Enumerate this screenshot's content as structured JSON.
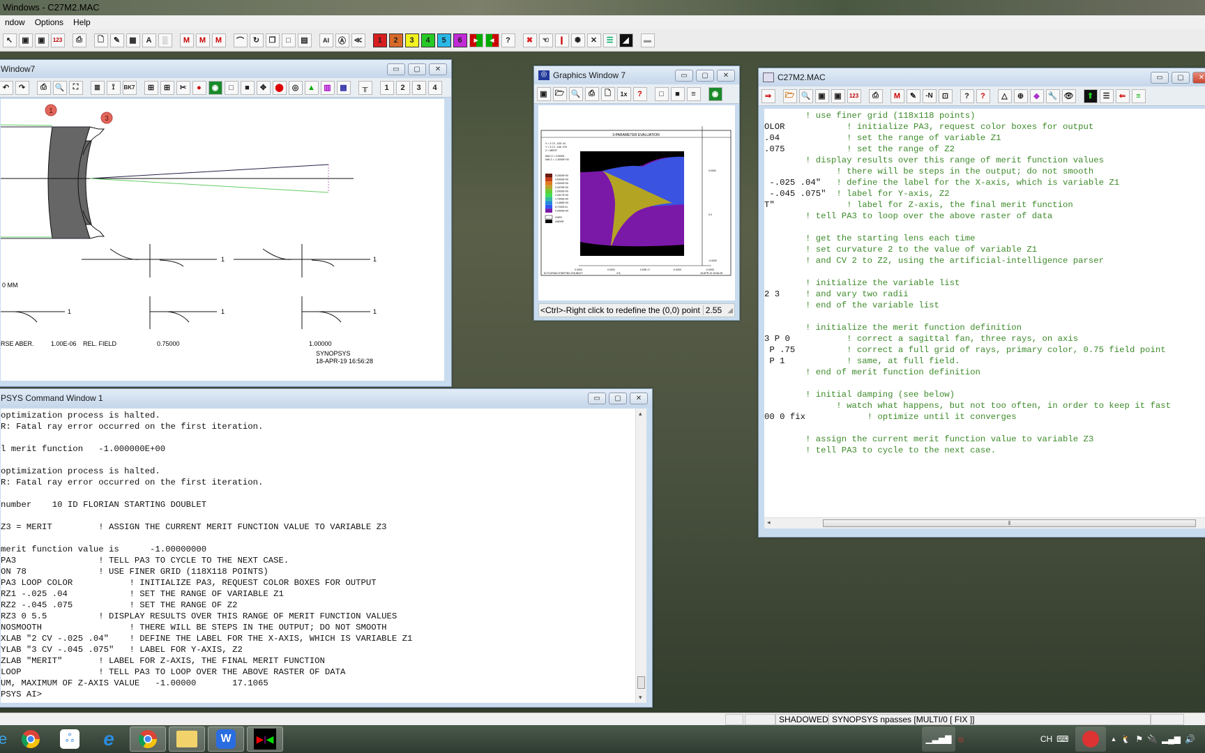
{
  "app": {
    "title": "Windows - C27M2.MAC",
    "menu": [
      "ndow",
      "Options",
      "Help"
    ]
  },
  "main_toolbar": {
    "numbered_buttons": [
      {
        "label": "1",
        "color": "#d81e1e"
      },
      {
        "label": "2",
        "color": "#d86a2a"
      },
      {
        "label": "3",
        "color": "#f2f21e"
      },
      {
        "label": "4",
        "color": "#26c926"
      },
      {
        "label": "5",
        "color": "#2ab8e6"
      },
      {
        "label": "6",
        "color": "#c22ad8"
      }
    ],
    "question_label": "?"
  },
  "lens_window": {
    "title": "Window7",
    "page_buttons": [
      "1",
      "2",
      "3",
      "4"
    ],
    "surface_markers": [
      "1",
      "3"
    ],
    "fan_plot_labels": {
      "units": "0   MM",
      "curve_end_label": "1",
      "aberration_label": "RSE ABER.",
      "scale": "1.00E-06",
      "rel_field_label": "REL. FIELD",
      "field_075": "0.75000",
      "field_100": "1.00000",
      "program": "SYNOPSYS",
      "timestamp": "18-APR-19  16:56:28"
    }
  },
  "graphics_window": {
    "title": "Graphics Window 7",
    "toolbar_1x": "1x",
    "plot": {
      "title": "3-PARAMETER EVALUATION",
      "x_label": "X =  2 CV -.025 .04",
      "y_label": "Y =  3 CV -.045 .075",
      "z_label": "Z =  MERIT",
      "max_z": "MAX Z =    0.00000",
      "min_z": "MIN Z =   -1.0000E+00",
      "legend": [
        "5.2500E+00",
        "4.6000E+00",
        "4.0000E+00",
        "3.4375E+00",
        "2.9000E+00",
        "2.2917E+00",
        "1.7000E+00",
        "1.1458E+00",
        "5.7292E-01",
        "0.0000E+00"
      ],
      "legend_colors": [
        "#6b1a10",
        "#c8401a",
        "#e07a20",
        "#b8a42a",
        "#66cc33",
        "#44dd55",
        "#33bb99",
        "#2288dd",
        "#3355ee",
        "#7a18a8"
      ],
      "over_label": "OVER",
      "under_label": "UNDER",
      "y_ticks": [
        "0.0000",
        "0.0",
        "-0.0000"
      ],
      "x_ticks": [
        "0.0000",
        "0.0000",
        "0.00E-17",
        "-0.0000",
        "-0.0000"
      ],
      "footer_left": "ID FLORIAN STARTING DOUBLET",
      "footer_mid": "3 N",
      "footer_right": "18-APR-19  16:56:28"
    },
    "status_text": "<Ctrl>-Right click to redefine the (0,0) point",
    "status_value": "2.55"
  },
  "macro_window": {
    "title": "C27M2.MAC",
    "toolbar_n": "-N",
    "lines": [
      {
        "code": "",
        "comment": "        ! use finer grid (118x118 points)"
      },
      {
        "code": "OLOR",
        "comment": "            ! initialize PA3, request color boxes for output"
      },
      {
        "code": ".04",
        "comment": "             ! set the range of variable Z1"
      },
      {
        "code": ".075",
        "comment": "            ! set the range of Z2"
      },
      {
        "code": "",
        "comment": "        ! display results over this range of merit function values"
      },
      {
        "code": "",
        "comment": "              ! there will be steps in the output; do not smooth"
      },
      {
        "code": " -.025 .04\"",
        "comment": "   ! define the label for the X-axis, which is variable Z1"
      },
      {
        "code": " -.045 .075\"",
        "comment": "  ! label for Y-axis, Z2"
      },
      {
        "code": "T\"",
        "comment": "              ! label for Z-axis, the final merit function"
      },
      {
        "code": "",
        "comment": "        ! tell PA3 to loop over the above raster of data"
      },
      {
        "code": "",
        "comment": ""
      },
      {
        "code": "",
        "comment": "        ! get the starting lens each time"
      },
      {
        "code": "",
        "comment": "        ! set curvature 2 to the value of variable Z1"
      },
      {
        "code": "",
        "comment": "        ! and CV 2 to Z2, using the artificial-intelligence parser"
      },
      {
        "code": "",
        "comment": ""
      },
      {
        "code": "",
        "comment": "        ! initialize the variable list"
      },
      {
        "code": "2 3",
        "comment": "     ! and vary two radii"
      },
      {
        "code": "",
        "comment": "        ! end of the variable list"
      },
      {
        "code": "",
        "comment": ""
      },
      {
        "code": "",
        "comment": "        ! initialize the merit function definition"
      },
      {
        "code": "3 P 0",
        "comment": "           ! correct a sagittal fan, three rays, on axis"
      },
      {
        "code": " P .75",
        "comment": "          ! correct a full grid of rays, primary color, 0.75 field point"
      },
      {
        "code": " P 1",
        "comment": "            ! same, at full field."
      },
      {
        "code": "",
        "comment": "        ! end of merit function definition"
      },
      {
        "code": "",
        "comment": ""
      },
      {
        "code": "",
        "comment": "        ! initial damping (see below)"
      },
      {
        "code": "",
        "comment": "              ! watch what happens, but not too often, in order to keep it fast"
      },
      {
        "code": "00 0 fix",
        "comment": "            ! optimize until it converges"
      },
      {
        "code": "",
        "comment": ""
      },
      {
        "code": "",
        "comment": "        ! assign the current merit function value to variable Z3"
      },
      {
        "code": "",
        "comment": "        ! tell PA3 to cycle to the next case."
      }
    ]
  },
  "command_window": {
    "title": "PSYS Command Window 1",
    "lines": [
      "optimization process is halted.",
      "R: Fatal ray error occurred on the first iteration.",
      "",
      "l merit function   -1.000000E+00",
      "",
      "optimization process is halted.",
      "R: Fatal ray error occurred on the first iteration.",
      "",
      "number    10 ID FLORIAN STARTING DOUBLET",
      "",
      "Z3 = MERIT         ! ASSIGN THE CURRENT MERIT FUNCTION VALUE TO VARIABLE Z3",
      "",
      "merit function value is      -1.00000000",
      "PA3                ! TELL PA3 TO CYCLE TO THE NEXT CASE.",
      "ON 78              ! USE FINER GRID (118X118 POINTS)",
      "PA3 LOOP COLOR           ! INITIALIZE PA3, REQUEST COLOR BOXES FOR OUTPUT",
      "RZ1 -.025 .04            ! SET THE RANGE OF VARIABLE Z1",
      "RZ2 -.045 .075           ! SET THE RANGE OF Z2",
      "RZ3 0 5.5          ! DISPLAY RESULTS OVER THIS RANGE OF MERIT FUNCTION VALUES",
      "NOSMOOTH                 ! THERE WILL BE STEPS IN THE OUTPUT; DO NOT SMOOTH",
      "XLAB \"2 CV -.025 .04\"    ! DEFINE THE LABEL FOR THE X-AXIS, WHICH IS VARIABLE Z1",
      "YLAB \"3 CV -.045 .075\"   ! LABEL FOR Y-AXIS, Z2",
      "ZLAB \"MERIT\"       ! LABEL FOR Z-AXIS, THE FINAL MERIT FUNCTION",
      "LOOP               ! TELL PA3 TO LOOP OVER THE ABOVE RASTER OF DATA",
      "UM, MAXIMUM OF Z-AXIS VALUE   -1.00000       17.1065",
      "PSYS AI>"
    ]
  },
  "status_bar": {
    "mode": "SHADOWED",
    "info": "SYNOPSYS npasses [MULTI/0 [ FIX ]]"
  },
  "taskbar": {
    "items": [
      "chrome",
      "baidu-netdisk",
      "internet-explorer",
      "chrome",
      "file-explorer",
      "wps",
      "synopsys"
    ],
    "tray_lang": "CH"
  }
}
